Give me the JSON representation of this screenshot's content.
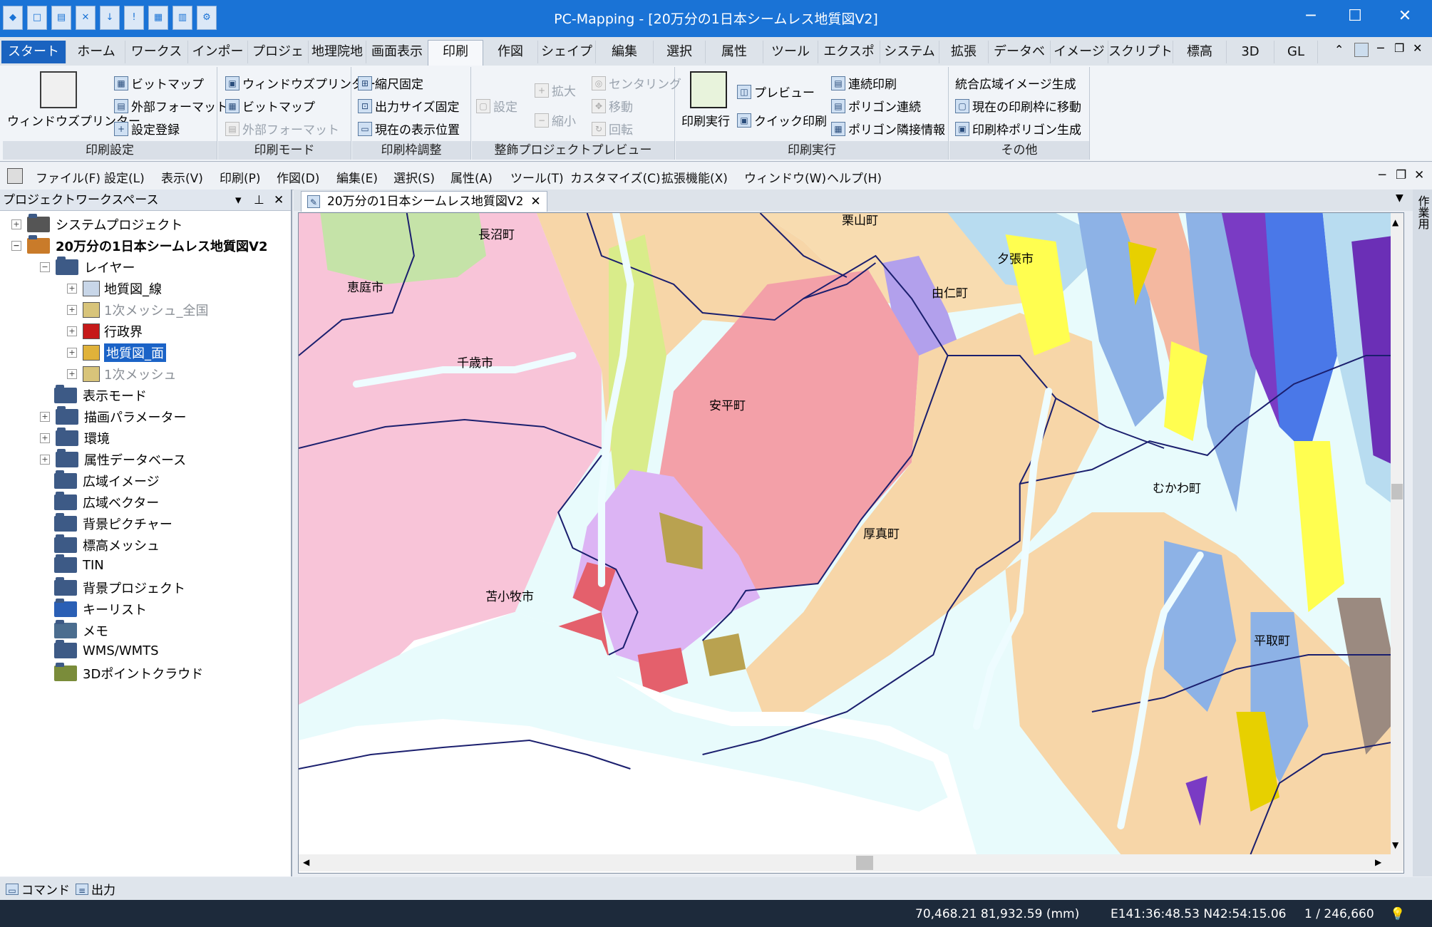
{
  "window": {
    "title": "PC-Mapping - [20万分の1日本シームレス地質図V2]",
    "controls": [
      "─",
      "☐",
      "✕"
    ]
  },
  "ribbon_tabs": [
    "スタート",
    "ホーム",
    "ワークスペー",
    "インポート",
    "プロジェクト",
    "地理院地図",
    "画面表示",
    "印刷",
    "作図",
    "シェイプ",
    "編集",
    "選択",
    "属性",
    "ツール",
    "エクスポート",
    "システム",
    "拡張",
    "データベース",
    "イメージ",
    "スクリプト",
    "標高",
    "3D",
    "GL"
  ],
  "ribbon": {
    "print_settings": {
      "label": "印刷設定",
      "big_button": "ウィンドウズプリンター",
      "items": [
        "ビットマップ",
        "外部フォーマット",
        "設定登録"
      ]
    },
    "print_mode": {
      "label": "印刷モード",
      "items": [
        "ウィンドウズプリンター",
        "ビットマップ",
        "外部フォーマット"
      ]
    },
    "frame_adjust": {
      "label": "印刷枠調整",
      "items": [
        "縮尺固定",
        "出力サイズ固定",
        "現在の表示位置"
      ]
    },
    "preview": {
      "label": "整飾プロジェクトプレビュー",
      "items": [
        "設定",
        "拡大",
        "縮小",
        "センタリング",
        "移動",
        "回転"
      ]
    },
    "execute": {
      "label": "印刷実行",
      "big_button": "印刷実行",
      "items": [
        "プレビュー",
        "クイック印刷",
        "連続印刷",
        "ポリゴン連続",
        "ポリゴン隣接情報"
      ]
    },
    "other": {
      "label": "その他",
      "items": [
        "統合広域イメージ生成",
        "現在の印刷枠に移動",
        "印刷枠ポリゴン生成"
      ]
    }
  },
  "menubar": [
    "ファイル(F)",
    "設定(L)",
    "表示(V)",
    "印刷(P)",
    "作図(D)",
    "編集(E)",
    "選択(S)",
    "属性(A)",
    "ツール(T)",
    "カスタマイズ(C)",
    "拡張機能(X)",
    "ウィンドウ(W)",
    "ヘルプ(H)"
  ],
  "panel": {
    "title": "プロジェクトワークスペース",
    "system_project": "システムプロジェクト",
    "project": "20万分の1日本シームレス地質図V2",
    "layer_folder": "レイヤー",
    "layers": [
      "地質図_線",
      "1次メッシュ_全国",
      "行政界",
      "地質図_面",
      "1次メッシュ"
    ],
    "folders": [
      "表示モード",
      "描画パラメーター",
      "環境",
      "属性データベース",
      "広域イメージ",
      "広域ベクター",
      "背景ピクチャー",
      "標高メッシュ",
      "TIN",
      "背景プロジェクト",
      "キーリスト",
      "メモ",
      "WMS/WMTS",
      "3Dポイントクラウド"
    ]
  },
  "document_tab": "20万分の1日本シームレス地質図V2",
  "side_tab": "作業用",
  "map_labels": [
    "長沼町",
    "栗山町",
    "夕張市",
    "恵庭市",
    "由仁町",
    "千歳市",
    "安平町",
    "むかわ町",
    "厚真町",
    "苫小牧市",
    "平取町"
  ],
  "bottom_tabs": [
    "コマンド",
    "出力"
  ],
  "status": {
    "coords": "70,468.21 81,932.59 (mm)",
    "latlon": "E141:36:48.53 N42:54:15.06",
    "scale": "1 / 246,660"
  }
}
